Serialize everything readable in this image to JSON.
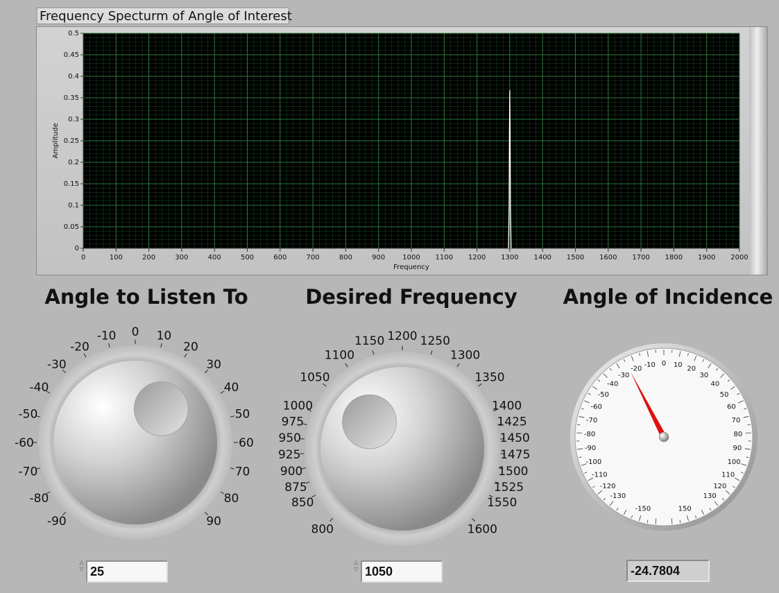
{
  "graph": {
    "title": "Frequency Specturm of Angle of Interest"
  },
  "chart_data": {
    "type": "line",
    "xlabel": "Frequency",
    "ylabel": "Amplitude",
    "xlim": [
      0,
      2000
    ],
    "ylim": [
      0,
      0.5
    ],
    "x_ticks": [
      0,
      100,
      200,
      300,
      400,
      500,
      600,
      700,
      800,
      900,
      1000,
      1100,
      1200,
      1300,
      1400,
      1500,
      1600,
      1700,
      1800,
      1900,
      2000
    ],
    "y_ticks": [
      "0",
      "0.05",
      "0.1",
      "0.15",
      "0.2",
      "0.25",
      "0.3",
      "0.35",
      "0.4",
      "0.45",
      "0.5"
    ],
    "grid": true,
    "background_color": "#000000",
    "grid_color": "#2f7f3f",
    "trace_color": "#ffffff",
    "series": [
      {
        "x": [
          1296,
          1298,
          1299,
          1300,
          1301,
          1302,
          1304
        ],
        "y": [
          0,
          0.1,
          0.275,
          0.368,
          0.275,
          0.1,
          0
        ]
      }
    ]
  },
  "controls": {
    "angle_knob": {
      "title": "Angle to Listen To",
      "scale_labels": [
        "-90",
        "-80",
        "-70",
        "-60",
        "-50",
        "-40",
        "-30",
        "-20",
        "-10",
        "0",
        "10",
        "20",
        "30",
        "40",
        "50",
        "60",
        "70",
        "80",
        "90"
      ],
      "value": "25",
      "min": -90,
      "max": 90
    },
    "frequency_knob": {
      "title": "Desired Frequency",
      "scale_labels": [
        "800",
        "850",
        "875",
        "900",
        "925",
        "950",
        "975",
        "1000",
        "1050",
        "1100",
        "1150",
        "1200",
        "1250",
        "1300",
        "1350",
        "1400",
        "1425",
        "1450",
        "1475",
        "1500",
        "1525",
        "1550",
        "1600"
      ],
      "value": "1050",
      "min": 800,
      "max": 1600
    },
    "incidence_gauge": {
      "title": "Angle of Incidence",
      "scale_labels": [
        "-150",
        "-130",
        "-120",
        "-110",
        "-100",
        "-90",
        "-80",
        "-70",
        "-60",
        "-50",
        "-40",
        "-30",
        "-20",
        "-10",
        "0",
        "10",
        "20",
        "30",
        "40",
        "50",
        "60",
        "70",
        "80",
        "90",
        "100",
        "110",
        "120",
        "130",
        "150"
      ],
      "value": "-24.7804",
      "needle_value": -24.7804,
      "needle_color": "#e01010"
    }
  }
}
